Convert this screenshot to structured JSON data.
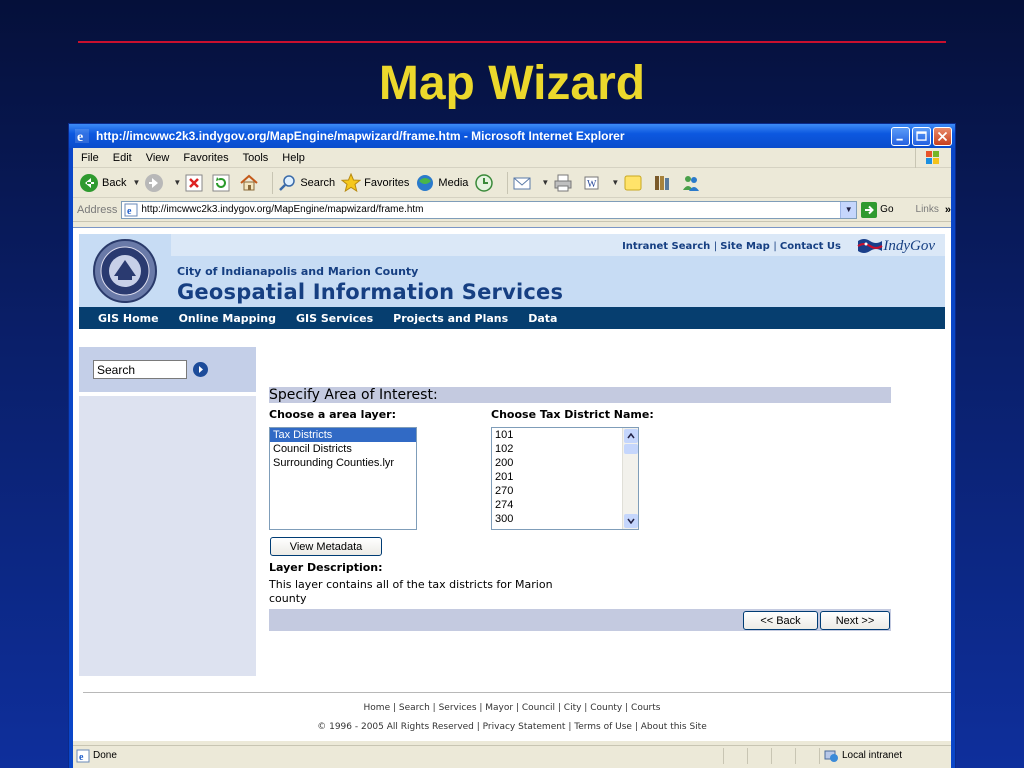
{
  "slide": {
    "title": "Map Wizard"
  },
  "browser": {
    "window_title": "http://imcwwc2k3.indygov.org/MapEngine/mapwizard/frame.htm - Microsoft Internet Explorer",
    "menu": [
      "File",
      "Edit",
      "View",
      "Favorites",
      "Tools",
      "Help"
    ],
    "toolbar": {
      "back": "Back",
      "search": "Search",
      "favorites": "Favorites",
      "media": "Media"
    },
    "address_label": "Address",
    "address_url": "http://imcwwc2k3.indygov.org/MapEngine/mapwizard/frame.htm",
    "go_label": "Go",
    "links_label": "Links",
    "status_text": "Done",
    "zone_text": "Local intranet"
  },
  "site": {
    "top_links": [
      "Intranet Search",
      "Site Map",
      "Contact Us"
    ],
    "brand": "IndyGov",
    "org_line": "City of Indianapolis and Marion County",
    "org_title": "Geospatial Information Services",
    "nav": [
      "GIS Home",
      "Online Mapping",
      "GIS Services",
      "Projects and Plans",
      "Data"
    ],
    "search_value": "Search"
  },
  "wizard": {
    "section_title": "Specify Area of Interest:",
    "area_layer_label": "Choose a area layer:",
    "area_layers": [
      "Tax Districts",
      "Council Districts",
      "Surrounding Counties.lyr"
    ],
    "selected_area_layer": "Tax Districts",
    "district_label": "Choose Tax District Name:",
    "districts": [
      "101",
      "102",
      "200",
      "201",
      "270",
      "274",
      "300"
    ],
    "view_metadata": "View Metadata",
    "layer_desc_label": "Layer Description:",
    "layer_desc": "This layer contains all of the tax districts for Marion county",
    "back_button": "<< Back",
    "next_button": "Next >>"
  },
  "footer": {
    "links": [
      "Home",
      "Search",
      "Services",
      "Mayor",
      "Council",
      "City",
      "County",
      "Courts"
    ],
    "copyright": "© 1996 - 2005 All Rights Reserved",
    "legal": [
      "Privacy Statement",
      "Terms of Use",
      "About this Site"
    ]
  },
  "colors": {
    "title": "#ecd82c",
    "nav_bg": "#063e6f",
    "header_bg": "#c7dcf4",
    "selected": "#316ac5"
  }
}
